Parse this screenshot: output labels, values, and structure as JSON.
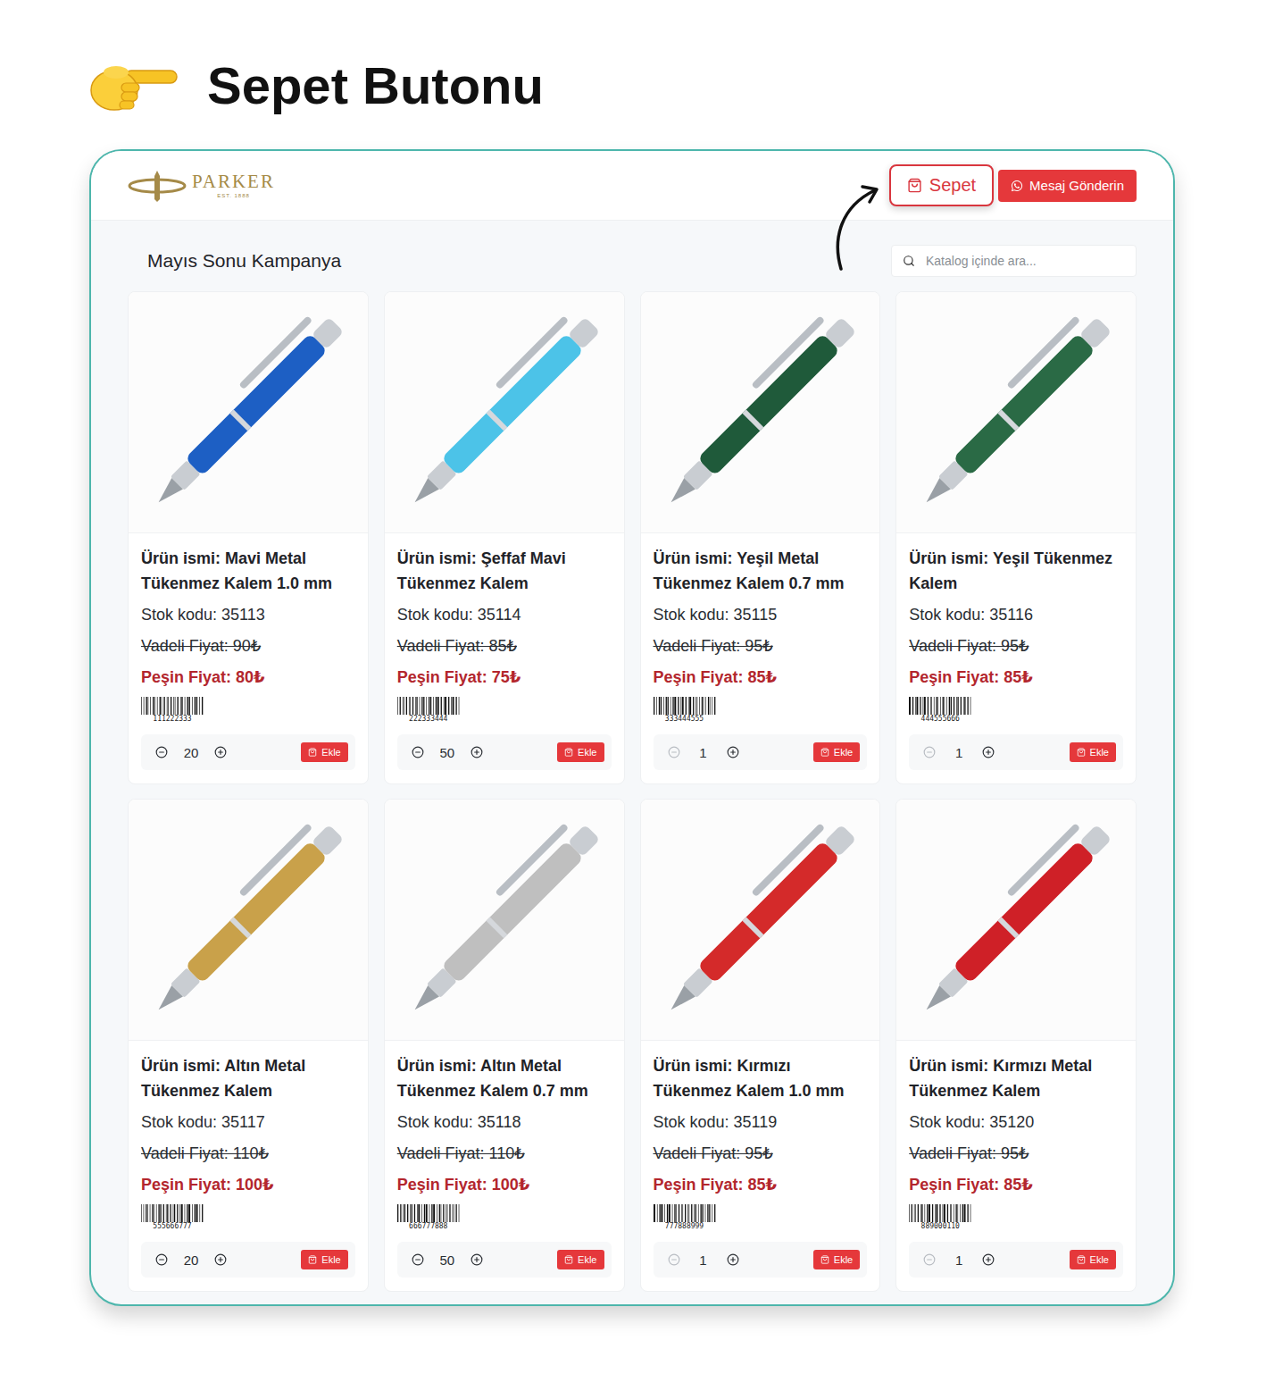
{
  "heading": {
    "title": "Sepet Butonu"
  },
  "brand": {
    "name": "PARKER",
    "tagline": "EST. 1888"
  },
  "nav": {
    "cart_button": "Sepet",
    "message_button": "Mesaj Gönderin"
  },
  "catalog": {
    "title": "Mayıs Sonu Kampanya"
  },
  "search": {
    "placeholder": "Katalog içinde ara..."
  },
  "products": [
    {
      "name": "Ürün ismi: Mavi Metal Tükenmez Kalem 1.0 mm",
      "stock_code": "Stok kodu: 35113",
      "term_price": "Vadeli Fiyat: 90₺",
      "cash_price": "Peşin Fiyat: 80₺",
      "barcode": "111222333",
      "quantity": "20",
      "minus_disabled": false,
      "add_button": "Ekle",
      "color": "#1d5fc4"
    },
    {
      "name": "Ürün ismi: Şeffaf Mavi Tükenmez Kalem",
      "stock_code": "Stok kodu: 35114",
      "term_price": "Vadeli Fiyat: 85₺",
      "cash_price": "Peşin Fiyat: 75₺",
      "barcode": "222333444",
      "quantity": "50",
      "minus_disabled": false,
      "add_button": "Ekle",
      "color": "#4cc3e8"
    },
    {
      "name": "Ürün ismi: Yeşil Metal Tükenmez Kalem 0.7 mm",
      "stock_code": "Stok kodu: 35115",
      "term_price": "Vadeli Fiyat: 95₺",
      "cash_price": "Peşin Fiyat: 85₺",
      "barcode": "333444555",
      "quantity": "1",
      "minus_disabled": true,
      "add_button": "Ekle",
      "color": "#1f5a3a"
    },
    {
      "name": "Ürün ismi: Yeşil Tükenmez Kalem",
      "stock_code": "Stok kodu: 35116",
      "term_price": "Vadeli Fiyat: 95₺",
      "cash_price": "Peşin Fiyat: 85₺",
      "barcode": "444555666",
      "quantity": "1",
      "minus_disabled": true,
      "add_button": "Ekle",
      "color": "#2a6a45"
    },
    {
      "name": "Ürün ismi: Altın Metal Tükenmez Kalem",
      "stock_code": "Stok kodu: 35117",
      "term_price": "Vadeli Fiyat: 110₺",
      "cash_price": "Peşin Fiyat: 100₺",
      "barcode": "555666777",
      "quantity": "20",
      "minus_disabled": false,
      "add_button": "Ekle",
      "color": "#c9a14a"
    },
    {
      "name": "Ürün ismi: Altın Metal Tükenmez Kalem 0.7 mm",
      "stock_code": "Stok kodu: 35118",
      "term_price": "Vadeli Fiyat: 110₺",
      "cash_price": "Peşin Fiyat: 100₺",
      "barcode": "666777888",
      "quantity": "50",
      "minus_disabled": false,
      "add_button": "Ekle",
      "color": "#bfbfbf"
    },
    {
      "name": "Ürün ismi: Kırmızı Tükenmez Kalem 1.0 mm",
      "stock_code": "Stok kodu: 35119",
      "term_price": "Vadeli Fiyat: 95₺",
      "cash_price": "Peşin Fiyat: 85₺",
      "barcode": "777888999",
      "quantity": "1",
      "minus_disabled": true,
      "add_button": "Ekle",
      "color": "#d42a2a"
    },
    {
      "name": "Ürün ismi: Kırmızı Metal Tükenmez Kalem",
      "stock_code": "Stok kodu: 35120",
      "term_price": "Vadeli Fiyat: 95₺",
      "cash_price": "Peşin Fiyat: 85₺",
      "barcode": "889000110",
      "quantity": "1",
      "minus_disabled": true,
      "add_button": "Ekle",
      "color": "#cf2027"
    }
  ]
}
